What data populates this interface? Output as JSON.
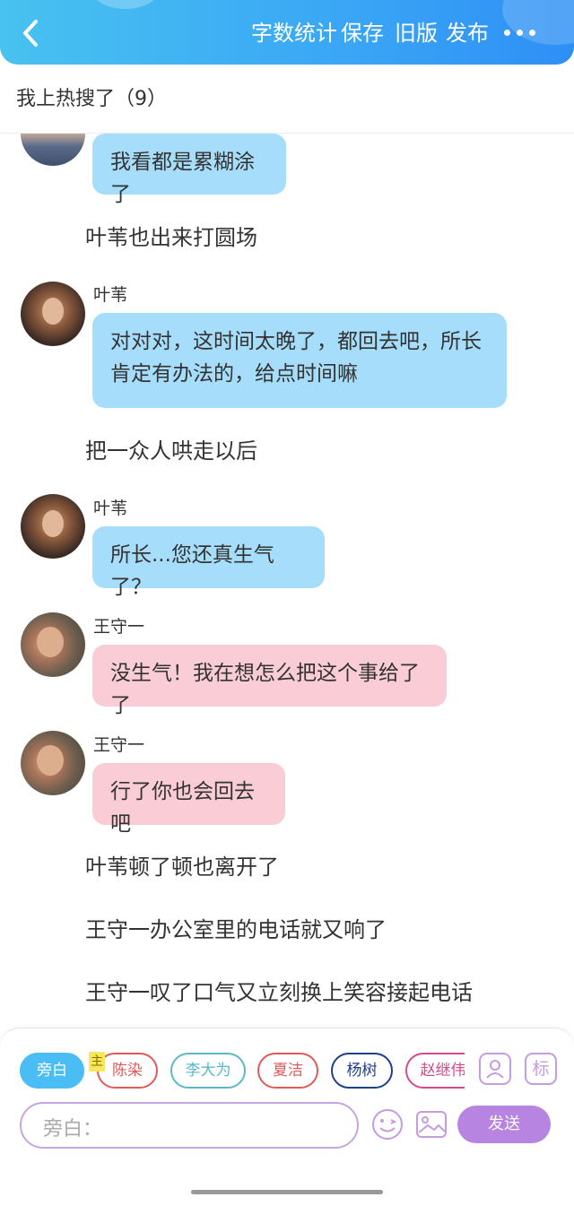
{
  "header": {
    "word_count_label": "字数统计",
    "save_label": "保存",
    "old_version_label": "旧版",
    "publish_label": "发布"
  },
  "title": "我上热搜了（9）",
  "chat": [
    {
      "type": "message",
      "speaker": "",
      "bubble_color": "blue",
      "text": "我看都是累糊涂了"
    },
    {
      "type": "narration",
      "text": "叶苇也出来打圆场"
    },
    {
      "type": "message",
      "speaker": "叶苇",
      "bubble_color": "blue",
      "lines": [
        "对对对，这时间太晚了，都回去吧，所长",
        "肯定有办法的，给点时间嘛"
      ]
    },
    {
      "type": "narration",
      "text": "把一众人哄走以后"
    },
    {
      "type": "message",
      "speaker": "叶苇",
      "bubble_color": "blue",
      "text": "所长...您还真生气了？"
    },
    {
      "type": "message",
      "speaker": "王守一",
      "bubble_color": "pink",
      "text": "没生气！我在想怎么把这个事给了了"
    },
    {
      "type": "message",
      "speaker": "王守一",
      "bubble_color": "pink",
      "text": "行了你也会回去吧"
    },
    {
      "type": "narration",
      "text": "叶苇顿了顿也离开了"
    },
    {
      "type": "narration",
      "text": "王守一办公室里的电话就又响了"
    },
    {
      "type": "narration",
      "text": "王守一叹了口气又立刻换上笑容接起电话"
    }
  ],
  "colors": {
    "blue_bubble": "#a6ddfa",
    "pink_bubble": "#f9ccd6",
    "header_start": "#48c2f0",
    "header_end": "#2e8ff5",
    "send": "#b884e2"
  },
  "characters": [
    {
      "label": "旁白",
      "active": true,
      "color": "#4bbdf5"
    },
    {
      "label": "陈染",
      "main_badge": "主",
      "color": "#e05a5a"
    },
    {
      "label": "李大为",
      "color": "#5cb8c6"
    },
    {
      "label": "夏洁",
      "color": "#e05a5a"
    },
    {
      "label": "杨树",
      "color": "#1f3f8a"
    },
    {
      "label": "赵继伟",
      "color": "#d24b8c"
    }
  ],
  "toolbar_icons": {
    "person": "person-card-icon",
    "mark": "标"
  },
  "input": {
    "placeholder": "旁白："
  },
  "send_label": "发送"
}
